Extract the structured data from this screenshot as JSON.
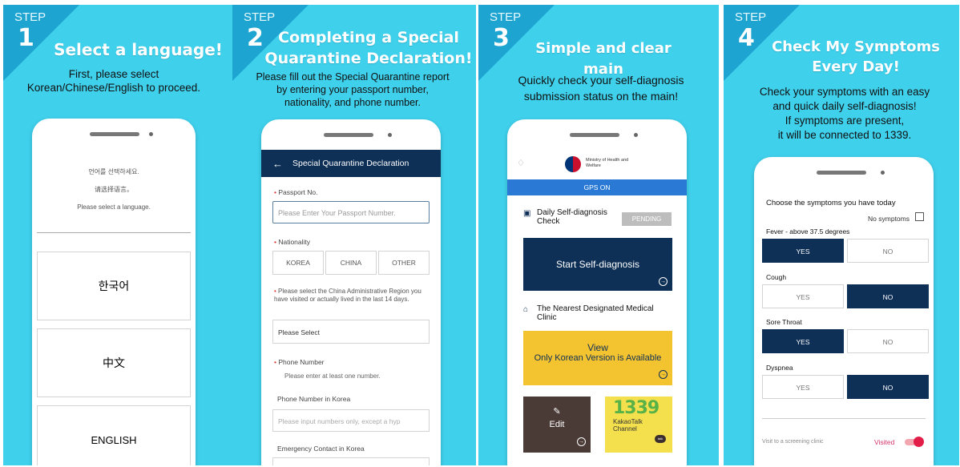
{
  "colors": {
    "panel": "#3fd0ec",
    "corner": "#1da4d0",
    "navy": "#0e2f56",
    "accent_blue": "#2a7ad5",
    "yellow": "#f4c430",
    "brown": "#4a3b36"
  },
  "steps": [
    {
      "label": "STEP",
      "num": "1",
      "title": "Select a language!",
      "desc": [
        "First, please select",
        "Korean/Chinese/English to proceed."
      ]
    },
    {
      "label": "STEP",
      "num": "2",
      "title": [
        "Completing a Special",
        "Quarantine Declaration!"
      ],
      "desc": [
        "Please fill out the Special Quarantine report",
        "by entering your passport number,",
        "nationality, and phone number."
      ]
    },
    {
      "label": "STEP",
      "num": "3",
      "title": "Simple and clear main",
      "desc": [
        "Quickly check your self-diagnosis",
        "submission status on the main!"
      ]
    },
    {
      "label": "STEP",
      "num": "4",
      "title": [
        "Check My Symptoms",
        "Every Day!"
      ],
      "desc": [
        "Check your symptoms with an easy",
        "and quick daily self-diagnosis!",
        "If symptoms are present,",
        "it will be connected to 1339."
      ]
    }
  ],
  "lang": {
    "prompts": [
      "언어를 선택하세요.",
      "请选择语言。",
      "Please select a language."
    ],
    "options": [
      "한국어",
      "中文",
      "ENGLISH"
    ]
  },
  "form": {
    "header": "Special Quarantine Declaration",
    "passport_label": "Passport No.",
    "passport_placeholder": "Please Enter Your Passport Number.",
    "nationality_label": "Nationality",
    "nationality_options": [
      "KOREA",
      "CHINA",
      "OTHER"
    ],
    "region_label": "Please select the China Administrative Region you have visited or actually lived in the last 14 days.",
    "region_select": "Please Select",
    "phone_label": "Phone Number",
    "phone_hint": "Please enter at least one number.",
    "phone_korea_label": "Phone Number in Korea",
    "phone_placeholder": "Please input numbers only, except a hyp",
    "emergency_label": "Emergency Contact in Korea"
  },
  "main": {
    "ministry": "Ministry of Health and Welfare",
    "gps": "GPS ON",
    "daily_title": "Daily Self-diagnosis Check",
    "status": "PENDING",
    "start_btn": "Start Self-diagnosis",
    "clinic_title": "The Nearest Designated Medical Clinic",
    "view_title": "View",
    "view_sub": "Only Korean Version is Available",
    "edit": "Edit",
    "kakao_num": "1339",
    "kakao_line1": "KakaoTalk",
    "kakao_line2": "Channel",
    "talk": "talk"
  },
  "symptoms": {
    "heading": "Choose the symptoms you have today",
    "no_symptoms": "No symptoms",
    "yes": "YES",
    "no": "NO",
    "items": [
      {
        "name": "Fever - above 37.5 degrees",
        "selected": "YES"
      },
      {
        "name": "Cough",
        "selected": "NO"
      },
      {
        "name": "Sore Throat",
        "selected": "YES"
      },
      {
        "name": "Dyspnea",
        "selected": "NO"
      }
    ],
    "visit_label": "Visit to a screening clinic",
    "visited": "Visited",
    "toggle_on": true
  }
}
